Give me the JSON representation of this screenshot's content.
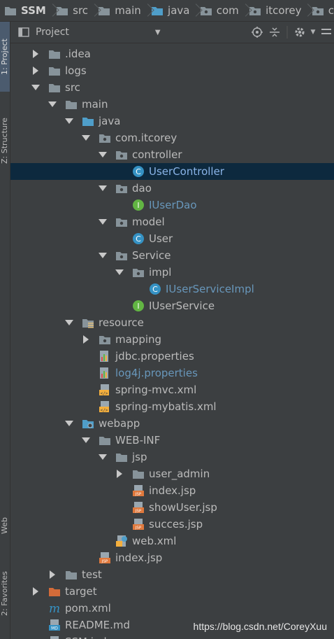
{
  "breadcrumb": [
    {
      "label": "SSM",
      "icon": "folder-icon"
    },
    {
      "label": "src",
      "icon": "folder-icon"
    },
    {
      "label": "main",
      "icon": "folder-icon"
    },
    {
      "label": "java",
      "icon": "source-folder-icon"
    },
    {
      "label": "com",
      "icon": "package-icon"
    },
    {
      "label": "itcorey",
      "icon": "package-icon"
    },
    {
      "label": "c",
      "icon": "package-icon"
    }
  ],
  "tool_strip": {
    "project_tab": "1: Project",
    "structure_tab": "Z: Structure",
    "web_tab": "Web",
    "favorites_tab": "2: Favorites"
  },
  "panel": {
    "title": "Project",
    "dropdown_glyph": "▼"
  },
  "tree": [
    {
      "label": ".idea",
      "depth": 0,
      "arrow": "collapsed",
      "icon": "folder"
    },
    {
      "label": "logs",
      "depth": 0,
      "arrow": "collapsed",
      "icon": "folder"
    },
    {
      "label": "src",
      "depth": 0,
      "arrow": "expanded",
      "icon": "folder"
    },
    {
      "label": "main",
      "depth": 1,
      "arrow": "expanded",
      "icon": "folder"
    },
    {
      "label": "java",
      "depth": 2,
      "arrow": "expanded",
      "icon": "source-folder"
    },
    {
      "label": "com.itcorey",
      "depth": 3,
      "arrow": "expanded",
      "icon": "package"
    },
    {
      "label": "controller",
      "depth": 4,
      "arrow": "expanded",
      "icon": "package"
    },
    {
      "label": "UserController",
      "depth": 5,
      "arrow": "none",
      "icon": "class",
      "style": "selected"
    },
    {
      "label": "dao",
      "depth": 4,
      "arrow": "expanded",
      "icon": "package"
    },
    {
      "label": "IUserDao",
      "depth": 5,
      "arrow": "none",
      "icon": "interface",
      "style": "blue"
    },
    {
      "label": "model",
      "depth": 4,
      "arrow": "expanded",
      "icon": "package"
    },
    {
      "label": "User",
      "depth": 5,
      "arrow": "none",
      "icon": "class"
    },
    {
      "label": "Service",
      "depth": 4,
      "arrow": "expanded",
      "icon": "package"
    },
    {
      "label": "impl",
      "depth": 5,
      "arrow": "expanded",
      "icon": "package"
    },
    {
      "label": "IUserServiceImpl",
      "depth": 6,
      "arrow": "none",
      "icon": "class",
      "style": "blue"
    },
    {
      "label": "IUserService",
      "depth": 5,
      "arrow": "none",
      "icon": "interface"
    },
    {
      "label": "resource",
      "depth": 2,
      "arrow": "expanded",
      "icon": "resource-folder"
    },
    {
      "label": "mapping",
      "depth": 3,
      "arrow": "collapsed",
      "icon": "package"
    },
    {
      "label": "jdbc.properties",
      "depth": 3,
      "arrow": "none",
      "icon": "properties"
    },
    {
      "label": "log4j.properties",
      "depth": 3,
      "arrow": "none",
      "icon": "properties",
      "style": "blue"
    },
    {
      "label": "spring-mvc.xml",
      "depth": 3,
      "arrow": "none",
      "icon": "xml"
    },
    {
      "label": "spring-mybatis.xml",
      "depth": 3,
      "arrow": "none",
      "icon": "xml"
    },
    {
      "label": "webapp",
      "depth": 2,
      "arrow": "expanded",
      "icon": "web-folder"
    },
    {
      "label": "WEB-INF",
      "depth": 3,
      "arrow": "expanded",
      "icon": "folder"
    },
    {
      "label": "jsp",
      "depth": 4,
      "arrow": "expanded",
      "icon": "folder"
    },
    {
      "label": "user_admin",
      "depth": 5,
      "arrow": "collapsed",
      "icon": "folder"
    },
    {
      "label": "index.jsp",
      "depth": 5,
      "arrow": "none",
      "icon": "jsp"
    },
    {
      "label": "showUser.jsp",
      "depth": 5,
      "arrow": "none",
      "icon": "jsp"
    },
    {
      "label": "succes.jsp",
      "depth": 5,
      "arrow": "none",
      "icon": "jsp"
    },
    {
      "label": "web.xml",
      "depth": 4,
      "arrow": "none",
      "icon": "webxml"
    },
    {
      "label": "index.jsp",
      "depth": 3,
      "arrow": "none",
      "icon": "jsp"
    },
    {
      "label": "test",
      "depth": 1,
      "arrow": "collapsed",
      "icon": "folder"
    },
    {
      "label": "target",
      "depth": 0,
      "arrow": "collapsed",
      "icon": "excluded-folder"
    },
    {
      "label": "pom.xml",
      "depth": 0,
      "arrow": "none",
      "icon": "maven"
    },
    {
      "label": "README.md",
      "depth": 0,
      "arrow": "none",
      "icon": "markdown"
    },
    {
      "label": "SSM.iml",
      "depth": 0,
      "arrow": "none",
      "icon": "iml"
    }
  ],
  "watermark": "https://blog.csdn.net/CoreyXuu",
  "colors": {
    "panel_bg": "#3c3f41",
    "selection_bg": "#0d293e",
    "text": "#bbbbbb",
    "link_blue": "#6897bb",
    "class_icon": "#3592c4",
    "interface_icon": "#62b543",
    "folder": "#87939a",
    "source_folder": "#4f9ec9",
    "excluded_folder": "#d36b39"
  }
}
